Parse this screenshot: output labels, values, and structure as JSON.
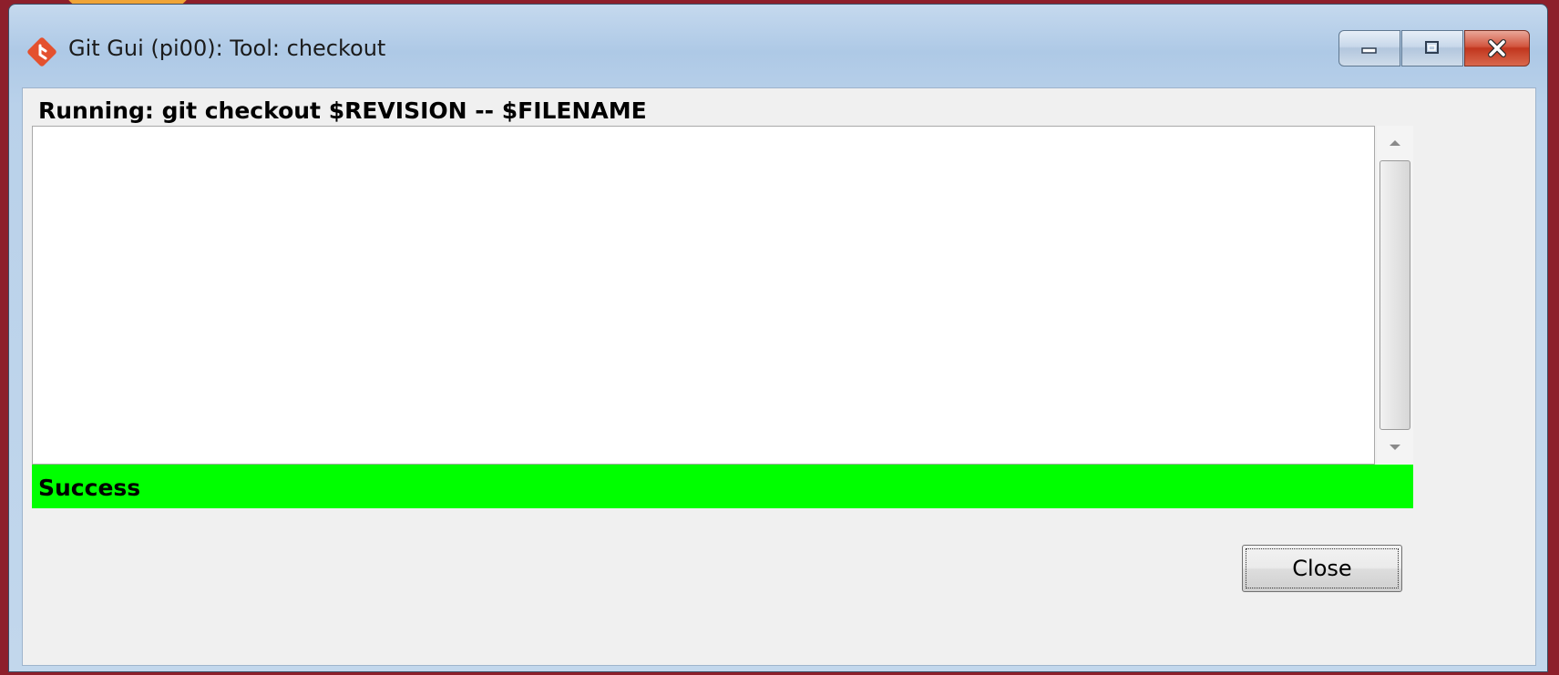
{
  "window": {
    "title": "Git Gui (pi00): Tool: checkout"
  },
  "dialog": {
    "command_label": "Running: git checkout $REVISION -- $FILENAME",
    "output_text": "",
    "status_text": "Success",
    "close_label": "Close"
  },
  "colors": {
    "status_success": "#00ff00",
    "git_icon": "#e4512e"
  },
  "icons": {
    "app": "git-logo-icon",
    "minimize": "minimize-icon",
    "maximize": "maximize-icon",
    "close": "close-icon",
    "scroll_up": "scroll-up-arrow-icon",
    "scroll_down": "scroll-down-arrow-icon"
  }
}
